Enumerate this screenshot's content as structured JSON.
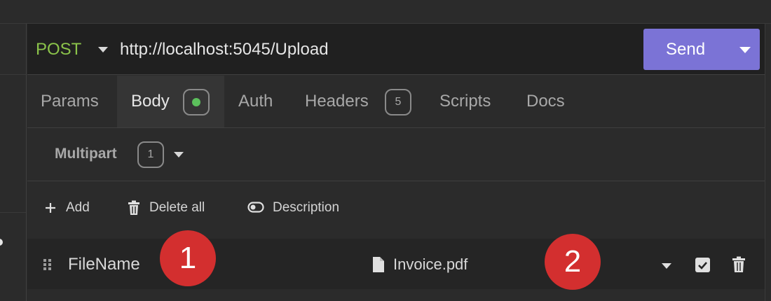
{
  "request": {
    "method": "POST",
    "url": "http://localhost:5045/Upload",
    "send_label": "Send"
  },
  "tabs": [
    {
      "label": "Params"
    },
    {
      "label": "Body",
      "active": true,
      "badge_type": "status-dot"
    },
    {
      "label": "Auth"
    },
    {
      "label": "Headers",
      "badge": "5"
    },
    {
      "label": "Scripts"
    },
    {
      "label": "Docs"
    }
  ],
  "body": {
    "mode_label": "Multipart",
    "mode_count": "1"
  },
  "actions": {
    "add": "Add",
    "delete_all": "Delete all",
    "description": "Description"
  },
  "fields": [
    {
      "name": "FileName",
      "file": "Invoice.pdf",
      "enabled": true
    }
  ],
  "annotations": {
    "marker1": "1",
    "marker2": "2"
  },
  "colors": {
    "method": "#8bc34a",
    "send_button": "#7b73d6",
    "marker": "#d32f2f",
    "status_dot": "#5cc05c"
  }
}
